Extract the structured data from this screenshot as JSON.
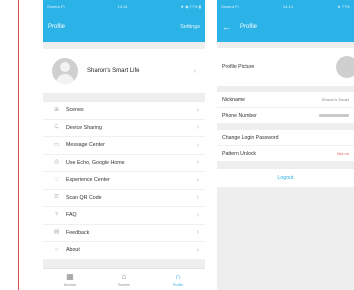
{
  "left_screen": {
    "status": {
      "left": "Sonera FI",
      "center": "14:14",
      "right": "★ ◉ 77% ▮"
    },
    "appbar": {
      "title": "Profile",
      "action": "Settings"
    },
    "profile": {
      "name": "Sharon's Smart Life"
    },
    "menu": [
      {
        "label": "Scenes",
        "icon": "scenes-icon",
        "glyph": "⊞"
      },
      {
        "label": "Device Sharing",
        "icon": "share-icon",
        "glyph": "⮎"
      },
      {
        "label": "Message Center",
        "icon": "message-icon",
        "glyph": "▭"
      },
      {
        "label": "Use Echo, Google Home",
        "icon": "voice-assistant-icon",
        "glyph": "◎"
      },
      {
        "label": "Experience Center",
        "icon": "experience-icon",
        "glyph": "♡"
      },
      {
        "label": "Scan QR Code",
        "icon": "qr-scan-icon",
        "glyph": "☰"
      },
      {
        "label": "FAQ",
        "icon": "faq-icon",
        "glyph": "?"
      },
      {
        "label": "Feedback",
        "icon": "feedback-icon",
        "glyph": "▤"
      },
      {
        "label": "About",
        "icon": "about-icon",
        "glyph": "○"
      }
    ],
    "tabs": [
      {
        "label": "Devices",
        "glyph": "▦"
      },
      {
        "label": "Scenes",
        "glyph": "⌂"
      },
      {
        "label": "Profile",
        "glyph": "∩"
      }
    ]
  },
  "right_screen": {
    "status": {
      "left": "Sonera FI",
      "center": "14:14",
      "right": "★ 77%"
    },
    "appbar": {
      "back": "←",
      "title": "Profile"
    },
    "rows": {
      "picture_label": "Profile Picture",
      "nickname_label": "Nickname",
      "nickname_value": "Sharon's Smart",
      "phone_label": "Phone Number",
      "password_label": "Change Login Password",
      "pattern_label": "Pattern Unlock",
      "pattern_value": "Not on"
    },
    "logout": "Logout"
  },
  "colors": {
    "accent": "#2bb2e6",
    "warning": "#e05a4f",
    "rule": "#d9534f"
  }
}
